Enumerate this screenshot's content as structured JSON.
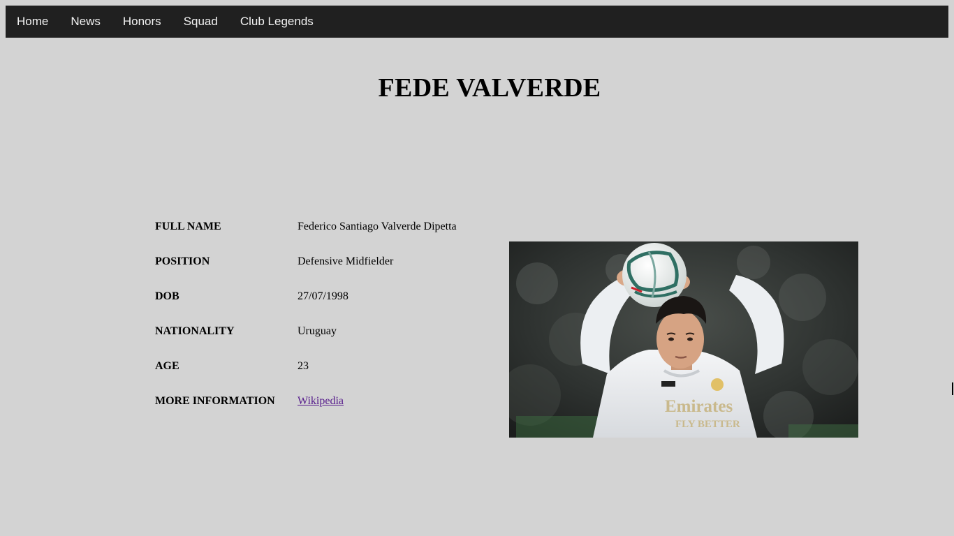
{
  "nav": {
    "items": [
      {
        "label": "Home"
      },
      {
        "label": "News"
      },
      {
        "label": "Honors"
      },
      {
        "label": "Squad"
      },
      {
        "label": "Club Legends"
      }
    ]
  },
  "page": {
    "title": "FEDE VALVERDE"
  },
  "info": {
    "rows": [
      {
        "label": "FULL NAME",
        "value": "Federico Santiago Valverde Dipetta"
      },
      {
        "label": "POSITION",
        "value": "Defensive Midfielder"
      },
      {
        "label": "DOB",
        "value": "27/07/1998"
      },
      {
        "label": "NATIONALITY",
        "value": "Uruguay"
      },
      {
        "label": "AGE",
        "value": "23"
      },
      {
        "label": "MORE INFORMATION",
        "link_text": "Wikipedia"
      }
    ]
  },
  "photo": {
    "shirt_text_line1": "Emirates",
    "shirt_text_line2": "FLY BETTER"
  },
  "colors": {
    "page_background": "#d3d3d3",
    "nav_background": "#202020",
    "nav_text": "#f2f2f2",
    "link_visited": "#551a8b"
  }
}
